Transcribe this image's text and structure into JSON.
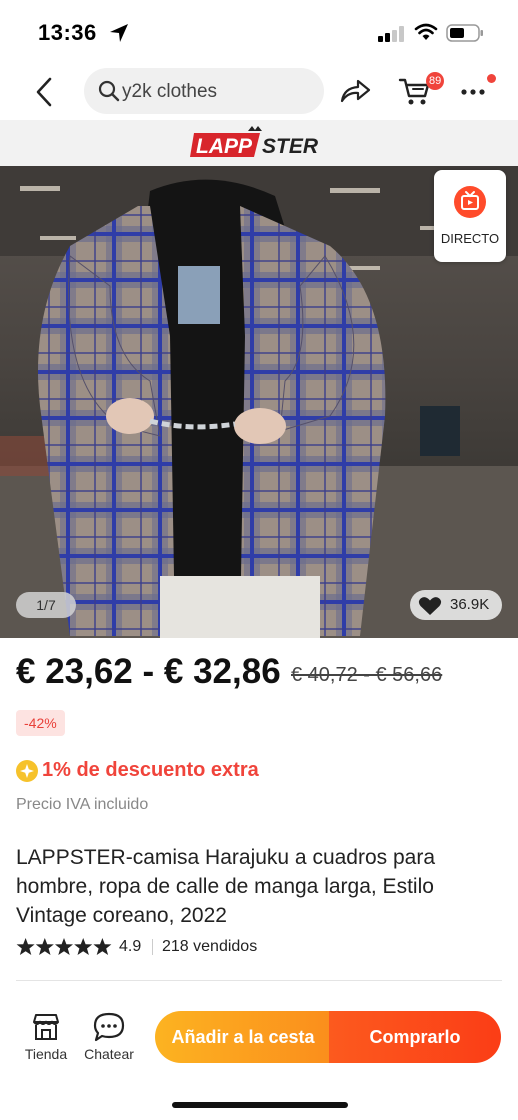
{
  "status_bar": {
    "time": "13:36",
    "icons": [
      "location-arrow-icon",
      "cellular-signal-icon",
      "wifi-icon",
      "battery-icon"
    ]
  },
  "header": {
    "search_text": "y2k clothes",
    "cart_badge": "89",
    "icons": [
      "back-chevron-icon",
      "search-icon",
      "share-icon",
      "cart-icon",
      "more-icon"
    ]
  },
  "store": {
    "logo_text_red": "LAPP",
    "logo_text_dark": "STER"
  },
  "gallery": {
    "live_label": "DIRECTO",
    "counter": "1/7",
    "likes": "36.9K"
  },
  "pricing": {
    "price_range": "€ 23,62 - € 32,86",
    "original_price": "€ 40,72 - € 56,66",
    "discount_badge": "-42%",
    "extra_discount": "1% de descuento extra",
    "vat_note": "Precio IVA incluido"
  },
  "product": {
    "title": "LAPPSTER-camisa Harajuku a cuadros para hombre, ropa de calle de manga larga, Estilo Vintage coreano, 2022",
    "rating": "4.9",
    "rating_stars": 5,
    "sold": "218 vendidos"
  },
  "bottom_bar": {
    "shop_label": "Tienda",
    "chat_label": "Chatear",
    "add_to_cart_label": "Añadir a la cesta",
    "buy_label": "Comprarlo"
  },
  "colors": {
    "accent_red": "#f0443b",
    "add_button_orange": "#fca11f",
    "buy_button_red": "#fb4a19",
    "discount_badge_bg": "#fde3e1",
    "extra_discount_icon": "#f6c22b"
  }
}
